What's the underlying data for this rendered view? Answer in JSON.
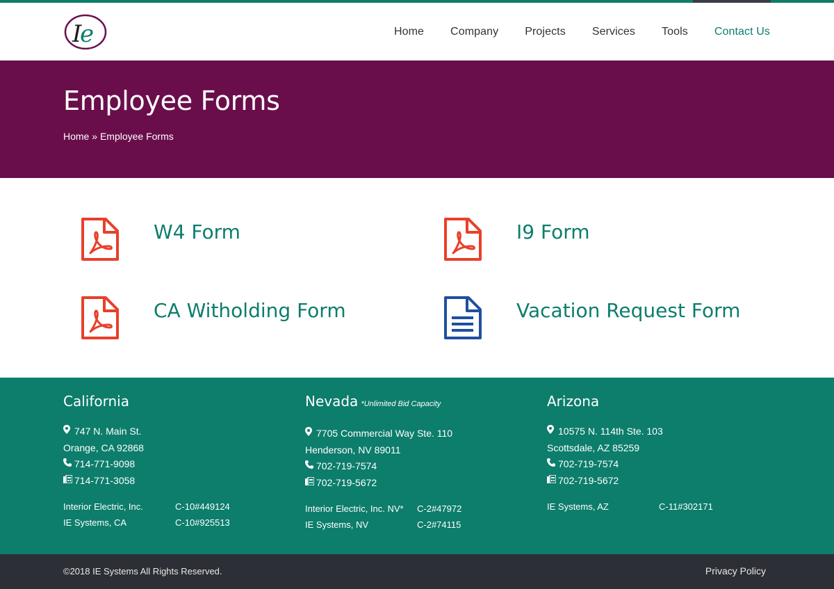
{
  "brand": {
    "logo_text": "IE",
    "primary_color": "#0d7d6c",
    "hero_color": "#6a0e4b",
    "footer_bottom_color": "#2d2f36"
  },
  "nav": {
    "items": [
      {
        "label": "Home"
      },
      {
        "label": "Company"
      },
      {
        "label": "Projects"
      },
      {
        "label": "Services"
      },
      {
        "label": "Tools"
      },
      {
        "label": "Contact Us",
        "active": true
      }
    ]
  },
  "hero": {
    "title": "Employee Forms",
    "breadcrumb_home": "Home",
    "breadcrumb_sep": " » ",
    "breadcrumb_current": "Employee Forms"
  },
  "forms": [
    {
      "label": "W4 Form",
      "icon": "pdf-icon"
    },
    {
      "label": "I9 Form",
      "icon": "pdf-icon"
    },
    {
      "label": "CA Witholding Form",
      "icon": "pdf-icon"
    },
    {
      "label": "Vacation Request Form",
      "icon": "document-icon"
    }
  ],
  "footer": {
    "california": {
      "title": "California",
      "street": "747 N. Main St.",
      "city": "Orange, CA 92868",
      "phone": "714-771-9098",
      "fax": "714-771-3058",
      "licenses": [
        {
          "name": "Interior Electric, Inc.",
          "number": "C-10#449124"
        },
        {
          "name": "IE Systems, CA",
          "number": "C-10#925513"
        }
      ]
    },
    "nevada": {
      "title": "Nevada",
      "note": "*Unlimited Bid Capacity",
      "street": "7705 Commercial Way Ste. 110",
      "city": "Henderson, NV 89011",
      "phone": "702-719-7574",
      "fax": "702-719-5672",
      "licenses": [
        {
          "name": "Interior Electric, Inc. NV*",
          "number": "C-2#47972"
        },
        {
          "name": "IE Systems, NV",
          "number": "C-2#74115"
        }
      ]
    },
    "arizona": {
      "title": "Arizona",
      "street": "10575 N. 114th Ste. 103",
      "city": "Scottsdale, AZ 85259",
      "phone": "702-719-7574",
      "fax": "702-719-5672",
      "licenses": [
        {
          "name": "IE Systems, AZ",
          "number": "C-11#302171"
        }
      ]
    }
  },
  "bottom": {
    "copyright": "©2018 IE Systems All Rights Reserved.",
    "privacy": "Privacy Policy"
  }
}
